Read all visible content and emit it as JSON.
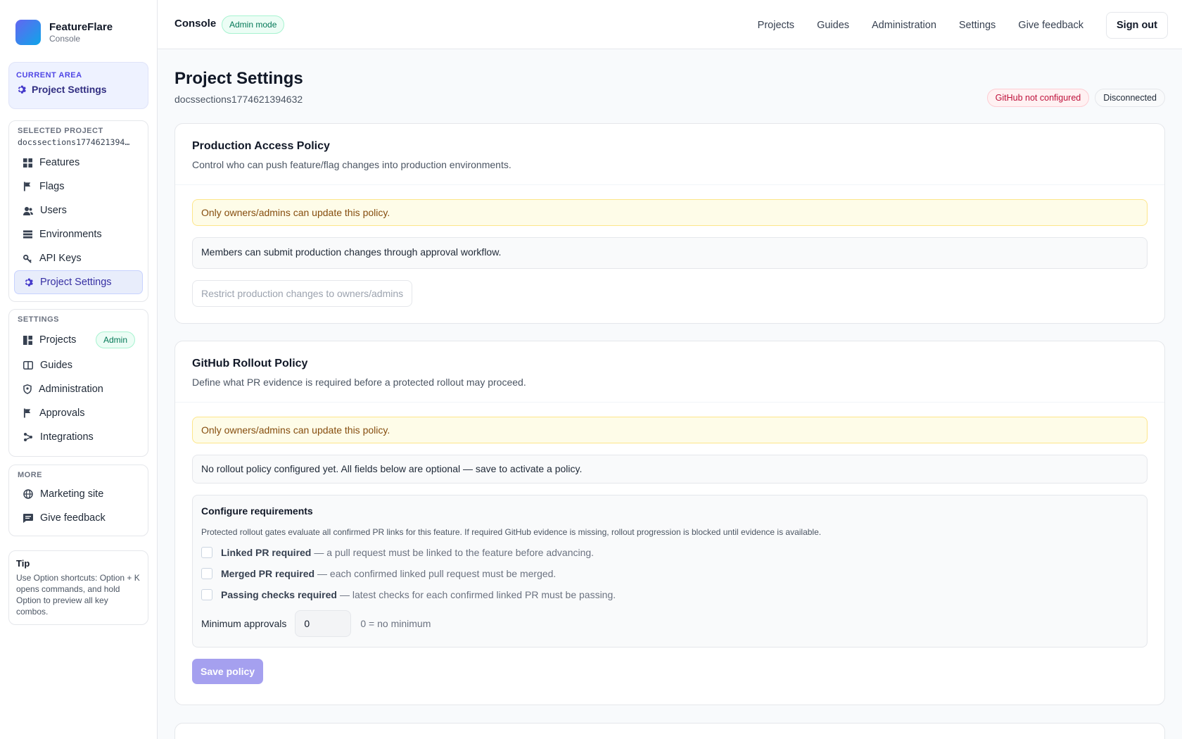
{
  "brand": {
    "name": "FeatureFlare",
    "subtitle": "Console"
  },
  "current_area": {
    "label": "Current area",
    "value": "Project Settings",
    "icon": "gear-icon"
  },
  "selected_project": {
    "label": "Selected project",
    "name": "docssections1774621394…",
    "items": [
      {
        "label": "Features",
        "icon": "grid-icon"
      },
      {
        "label": "Flags",
        "icon": "flag-icon"
      },
      {
        "label": "Users",
        "icon": "users-icon"
      },
      {
        "label": "Environments",
        "icon": "stack-icon"
      },
      {
        "label": "API Keys",
        "icon": "key-icon"
      },
      {
        "label": "Project Settings",
        "icon": "gear-icon"
      }
    ]
  },
  "settings_nav": {
    "label": "Settings",
    "items": [
      {
        "label": "Projects",
        "icon": "projects-icon",
        "badge": "Admin"
      },
      {
        "label": "Guides",
        "icon": "book-icon"
      },
      {
        "label": "Administration",
        "icon": "shield-icon"
      },
      {
        "label": "Approvals",
        "icon": "flag-icon"
      },
      {
        "label": "Integrations",
        "icon": "integrations-icon"
      }
    ]
  },
  "more_nav": {
    "label": "More",
    "items": [
      {
        "label": "Marketing site",
        "icon": "globe-icon"
      },
      {
        "label": "Give feedback",
        "icon": "message-icon"
      }
    ]
  },
  "tip": {
    "title": "Tip",
    "text": "Use Option shortcuts: Option + K opens commands, and hold Option to preview all key combos."
  },
  "topbar": {
    "title": "Console",
    "mode_badge": "Admin mode",
    "links": [
      "Projects",
      "Guides",
      "Administration",
      "Settings",
      "Give feedback"
    ],
    "signout": "Sign out"
  },
  "page": {
    "title": "Project Settings",
    "project_id": "docssections1774621394632",
    "status_github": "GitHub not configured",
    "status_connection": "Disconnected"
  },
  "production_policy": {
    "title": "Production Access Policy",
    "description": "Control who can push feature/flag changes into production environments.",
    "warning": "Only owners/admins can update this policy.",
    "info": "Members can submit production changes through approval workflow.",
    "restrict_button": "Restrict production changes to owners/admins"
  },
  "github_policy": {
    "title": "GitHub Rollout Policy",
    "description": "Define what PR evidence is required before a protected rollout may proceed.",
    "warning": "Only owners/admins can update this policy.",
    "info": "No rollout policy configured yet. All fields below are optional — save to activate a policy.",
    "requirements_title": "Configure requirements",
    "requirements_note": "Protected rollout gates evaluate all confirmed PR links for this feature. If required GitHub evidence is missing, rollout progression is blocked until evidence is available.",
    "checks": [
      {
        "label": "Linked PR required",
        "detail": "— a pull request must be linked to the feature before advancing.",
        "checked": false
      },
      {
        "label": "Merged PR required",
        "detail": "— each confirmed linked pull request must be merged.",
        "checked": false
      },
      {
        "label": "Passing checks required",
        "detail": "— latest checks for each confirmed linked PR must be passing.",
        "checked": false
      }
    ],
    "min_approvals_label": "Minimum approvals",
    "min_approvals_value": "0",
    "min_approvals_hint": "0 = no minimum",
    "save_button": "Save policy"
  },
  "colors": {
    "accent": "#4f46e5",
    "warning_bg": "#fefce8",
    "danger": "#be123c",
    "success": "#047857"
  }
}
